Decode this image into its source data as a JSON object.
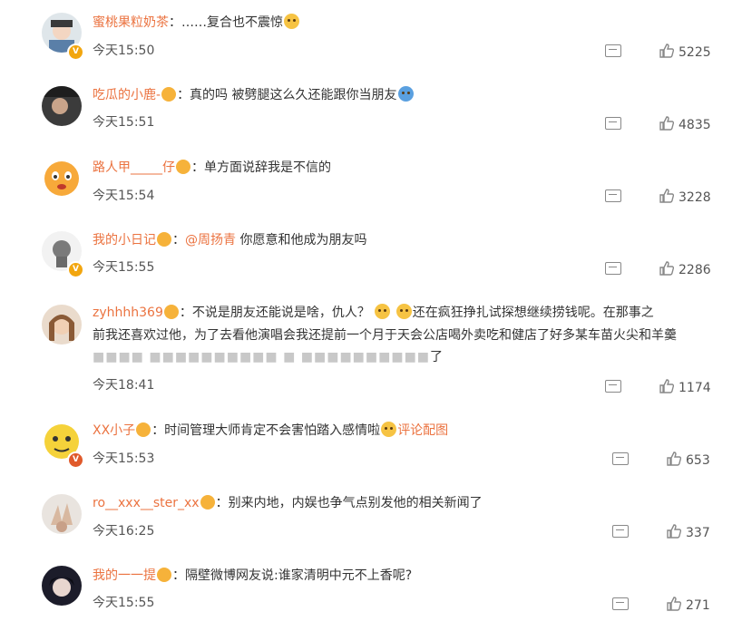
{
  "comments": [
    {
      "nick": "蜜桃果粒奶茶",
      "text": "：……复合也不震惊",
      "time": "今天15:50",
      "likes": "5225"
    },
    {
      "nick": "吃瓜的小鹿-",
      "text": "：真的吗 被劈腿这么久还能跟你当朋友",
      "time": "今天15:51",
      "likes": "4835"
    },
    {
      "nick": "路人甲_____仔",
      "text": "：单方面说辞我是不信的",
      "time": "今天15:54",
      "likes": "3228"
    },
    {
      "nick": "我的小日记",
      "text": "：",
      "mention": "@周扬青",
      "text2": " 你愿意和他成为朋友吗",
      "time": "今天15:55",
      "likes": "2286"
    },
    {
      "nick": "zyhhhh369",
      "text": "：不说是朋友还能说是啥，仇人？",
      "text2": "还在疯狂挣扎试探想继续捞钱呢。在那事之",
      "line2": "前我还喜欢过他，为了去看他演唱会我还提前一个月于天会公店喝外卖吃和健店了好多某车苗火尖和羊羹",
      "line3": "了",
      "time": "今天18:41",
      "likes": "1174"
    },
    {
      "nick": "XX小子",
      "text": "：时间管理大师肯定不会害怕踏入感情啦",
      "link": "评论配图",
      "time": "今天15:53",
      "likes": "653"
    },
    {
      "nick": "ro__xxx__ster_xx",
      "text": "：别来内地，内娱也争气点别发他的相关新闻了",
      "time": "今天16:25",
      "likes": "337"
    },
    {
      "nick": "我的一一提",
      "text": "：隔壁微博网友说:谁家清明中元不上香呢?",
      "time": "今天15:55",
      "likes": "271"
    }
  ]
}
